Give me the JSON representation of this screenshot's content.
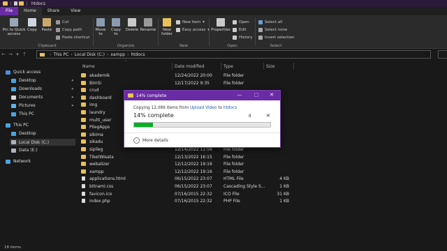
{
  "window": {
    "title": "htdocs"
  },
  "tabs": [
    "File",
    "Home",
    "Share",
    "View"
  ],
  "ribbon": {
    "clipboard": {
      "label": "Clipboard",
      "pin": "Pin to Quick access",
      "copy": "Copy",
      "paste": "Paste",
      "cut": "Cut",
      "copy_path": "Copy path",
      "paste_shortcut": "Paste shortcut"
    },
    "organize": {
      "label": "Organize",
      "move_to": "Move to",
      "copy_to": "Copy to",
      "delete": "Delete",
      "rename": "Rename"
    },
    "new": {
      "label": "New",
      "new_folder": "New folder",
      "new_item": "New item",
      "easy_access": "Easy access"
    },
    "open": {
      "label": "Open",
      "properties": "Properties",
      "open": "Open",
      "edit": "Edit",
      "history": "History"
    },
    "select": {
      "label": "Select",
      "select_all": "Select all",
      "select_none": "Select none",
      "invert": "Invert selection"
    }
  },
  "address": {
    "crumbs": [
      "This PC",
      "Local Disk (C:)",
      "xampp",
      "htdocs"
    ]
  },
  "nav": {
    "quick_access": "Quick access",
    "items": [
      "Desktop",
      "Downloads",
      "Documents",
      "Pictures",
      "This PC"
    ],
    "this_pc": "This PC",
    "this_pc_items": [
      "Desktop",
      "Local Disk (C:)",
      "Data (E:)"
    ],
    "network": "Network"
  },
  "columns": {
    "name": "Name",
    "date": "Date modified",
    "type": "Type",
    "size": "Size"
  },
  "files": [
    {
      "name": "akademik",
      "date": "12/24/2022 20:00",
      "type": "File folder",
      "size": "",
      "kind": "folder"
    },
    {
      "name": "BimSi",
      "date": "12/17/2022 9:35",
      "type": "File folder",
      "size": "",
      "kind": "folder"
    },
    {
      "name": "crud",
      "date": "",
      "type": "",
      "size": "",
      "kind": "folder"
    },
    {
      "name": "dashboard",
      "date": "",
      "type": "",
      "size": "",
      "kind": "folder"
    },
    {
      "name": "img",
      "date": "",
      "type": "",
      "size": "",
      "kind": "folder"
    },
    {
      "name": "laundry",
      "date": "",
      "type": "",
      "size": "",
      "kind": "folder"
    },
    {
      "name": "multi_user",
      "date": "",
      "type": "",
      "size": "",
      "kind": "folder"
    },
    {
      "name": "PilegApps",
      "date": "",
      "type": "",
      "size": "",
      "kind": "folder"
    },
    {
      "name": "sibima",
      "date": "",
      "type": "",
      "size": "",
      "kind": "folder"
    },
    {
      "name": "sikadu",
      "date": "",
      "type": "",
      "size": "",
      "kind": "folder"
    },
    {
      "name": "sipileg",
      "date": "12/14/2022 11:56",
      "type": "File folder",
      "size": "",
      "kind": "folder"
    },
    {
      "name": "TiketWisata",
      "date": "12/13/2022 16:15",
      "type": "File folder",
      "size": "",
      "kind": "folder"
    },
    {
      "name": "webalizer",
      "date": "12/12/2022 19:16",
      "type": "File folder",
      "size": "",
      "kind": "folder"
    },
    {
      "name": "xampp",
      "date": "12/12/2022 19:16",
      "type": "File folder",
      "size": "",
      "kind": "folder"
    },
    {
      "name": "applications.html",
      "date": "06/15/2022 23:07",
      "type": "HTML File",
      "size": "4 KB",
      "kind": "doc"
    },
    {
      "name": "bitnami.css",
      "date": "06/15/2022 23:07",
      "type": "Cascading Style S...",
      "size": "1 KB",
      "kind": "doc"
    },
    {
      "name": "favicon.ico",
      "date": "07/16/2015 22:32",
      "type": "ICO File",
      "size": "31 KB",
      "kind": "doc"
    },
    {
      "name": "index.php",
      "date": "07/16/2015 22:32",
      "type": "PHP File",
      "size": "1 KB",
      "kind": "doc"
    }
  ],
  "status": {
    "items": "18 items"
  },
  "dialog": {
    "title": "14% complete",
    "copying_prefix": "Copying 12,089 items from",
    "source": "Upload Video",
    "to": "to",
    "dest": "htdocs",
    "percent_text": "14% complete",
    "progress": 0.14,
    "pause": "II",
    "cancel": "✕",
    "more": "More details"
  },
  "colors": {
    "accent": "#6a2ca4",
    "folder": "#e8c15a",
    "progress": "#06b025"
  }
}
